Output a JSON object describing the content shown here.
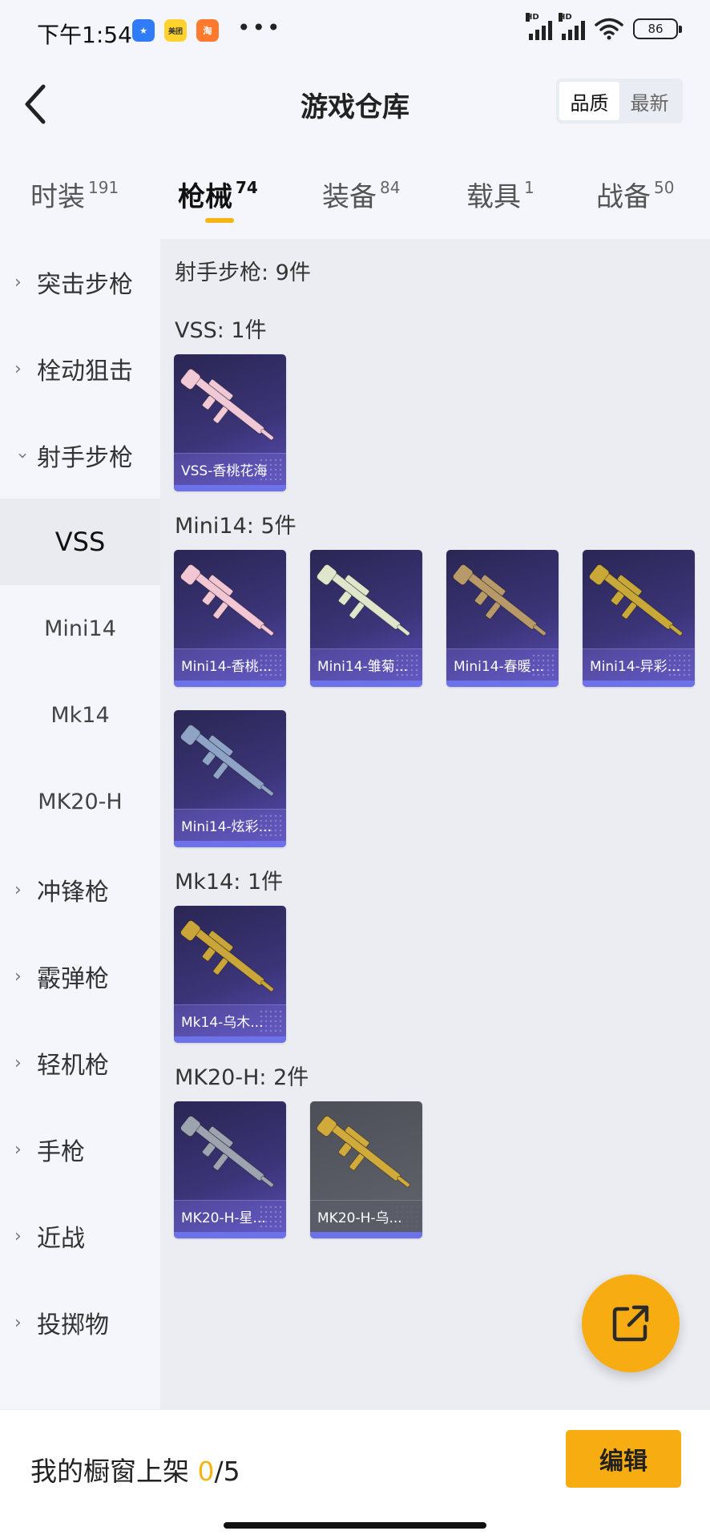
{
  "status_bar": {
    "time": "下午1:54",
    "apps": [
      "★",
      "美团",
      "淘"
    ],
    "dots": "•••",
    "network_1": "HD",
    "network_2": "HD",
    "battery": "86"
  },
  "header": {
    "title": "游戏仓库",
    "sort_options": [
      {
        "label": "品质",
        "active": true
      },
      {
        "label": "最新",
        "active": false
      }
    ]
  },
  "category_tabs": [
    {
      "label": "时装",
      "count": "191",
      "active": false
    },
    {
      "label": "枪械",
      "count": "74",
      "active": true
    },
    {
      "label": "装备",
      "count": "84",
      "active": false
    },
    {
      "label": "载具",
      "count": "1",
      "active": false
    },
    {
      "label": "战备",
      "count": "50",
      "active": false
    }
  ],
  "sidebar": {
    "items": [
      {
        "label": "突击步枪",
        "expanded": false
      },
      {
        "label": "栓动狙击",
        "expanded": false
      },
      {
        "label": "射手步枪",
        "expanded": true
      },
      {
        "label": "冲锋枪",
        "expanded": false
      },
      {
        "label": "霰弹枪",
        "expanded": false
      },
      {
        "label": "轻机枪",
        "expanded": false
      },
      {
        "label": "手枪",
        "expanded": false
      },
      {
        "label": "近战",
        "expanded": false
      },
      {
        "label": "投掷物",
        "expanded": false
      }
    ],
    "sub_items": [
      {
        "label": "VSS",
        "active": true
      },
      {
        "label": "Mini14",
        "active": false
      },
      {
        "label": "Mk14",
        "active": false
      },
      {
        "label": "MK20-H",
        "active": false
      }
    ]
  },
  "content": {
    "section_title": "射手步枪: 9件",
    "groups": [
      {
        "title": "VSS: 1件",
        "items": [
          {
            "label": "VSS-香桃花海",
            "color": "#f0c8d6"
          }
        ]
      },
      {
        "title": "Mini14: 5件",
        "items": [
          {
            "label": "Mini14-香桃...",
            "color": "#f3c6d4"
          },
          {
            "label": "Mini14-雏菊...",
            "color": "#dfe6cc"
          },
          {
            "label": "Mini14-春暖...",
            "color": "#b89a6a"
          },
          {
            "label": "Mini14-异彩...",
            "color": "#c9a83a"
          },
          {
            "label": "Mini14-炫彩...",
            "color": "#8fa3c6"
          }
        ]
      },
      {
        "title": "Mk14: 1件",
        "items": [
          {
            "label": "Mk14-乌木...",
            "color": "#c9a53a"
          }
        ]
      },
      {
        "title": "MK20-H: 2件",
        "items": [
          {
            "label": "MK20-H-星...",
            "color": "#9ea3b0"
          },
          {
            "label": "MK20-H-乌...",
            "color": "#d1aa3c"
          }
        ]
      }
    ]
  },
  "bottom_bar": {
    "shelf_label": "我的橱窗上架 ",
    "shelf_current": "0",
    "shelf_total": "/5",
    "edit_label": "编辑"
  },
  "colors": {
    "accent": "#f7ac12",
    "card_bg": "#3b3477",
    "card_bar": "#6d72ea"
  }
}
